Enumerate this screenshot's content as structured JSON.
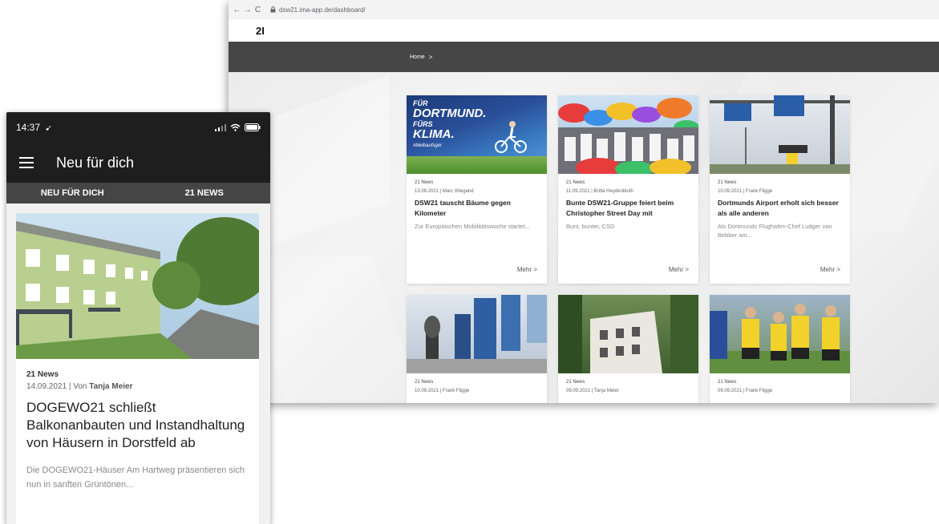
{
  "browser": {
    "url": "dsw21.ima-app.de/dashboard/",
    "logo": "2I",
    "breadcrumb": {
      "home": "Home",
      "separator": ">"
    },
    "cards": [
      {
        "category": "21 News",
        "meta": "13.09.2021 | Marc Wiegand",
        "title": "DSW21 tauscht Bäume gegen Kilometer",
        "teaser": "Zur Europäischen Mobilitätswoche startet...",
        "more": "Mehr >",
        "image_text": {
          "line1": "FÜR",
          "line2": "DORTMUND.",
          "line3": "FÜRS",
          "line4": "KLIMA.",
          "hashtag": "#bleibaufsger"
        }
      },
      {
        "category": "21 News",
        "meta": "11.09.2021 | Britta Heydenbluth",
        "title": "Bunte DSW21-Gruppe feiert beim Christopher Street Day mit",
        "teaser": "Bunt, bunter, CSD",
        "more": "Mehr >"
      },
      {
        "category": "21 News",
        "meta": "10.09.2021 | Frank Fligge",
        "title": "Dortmunds Airport erholt sich besser als alle anderen",
        "teaser": "Als Dortmunds Flughafen-Chef Ludger van Bebber am...",
        "more": "Mehr >"
      },
      {
        "category": "21 News",
        "meta": "10.09.2021 | Frank Fligge"
      },
      {
        "category": "21 News",
        "meta": "09.09.2021 | Tanja Meier"
      },
      {
        "category": "21 News",
        "meta": "09.09.2021 | Frank Fligge"
      }
    ]
  },
  "phone": {
    "time": "14:37",
    "app_title": "Neu für dich",
    "tabs": [
      "NEU FÜR DICH",
      "21 NEWS"
    ],
    "article": {
      "category": "21 News",
      "date_prefix": "14.09.2021 | Von",
      "author": "Tanja Meier",
      "title": "DOGEWO21 schließt Balkonanbauten und Instandhaltung von Häusern in Dorstfeld ab",
      "teaser": "Die DOGEWO21-Häuser Am Hartweg präsentieren sich nun in sanften Grüntönen..."
    }
  },
  "colors": {
    "dark_bar": "#464646",
    "app_bar": "#1e1e1e",
    "tab_bar": "#454545",
    "accent_yellow": "#f2d12a"
  },
  "icons": [
    "back-arrow-icon",
    "forward-arrow-icon",
    "reload-icon",
    "lock-icon",
    "location-arrow-icon",
    "signal-icon",
    "wifi-icon",
    "battery-icon",
    "hamburger-menu-icon"
  ]
}
